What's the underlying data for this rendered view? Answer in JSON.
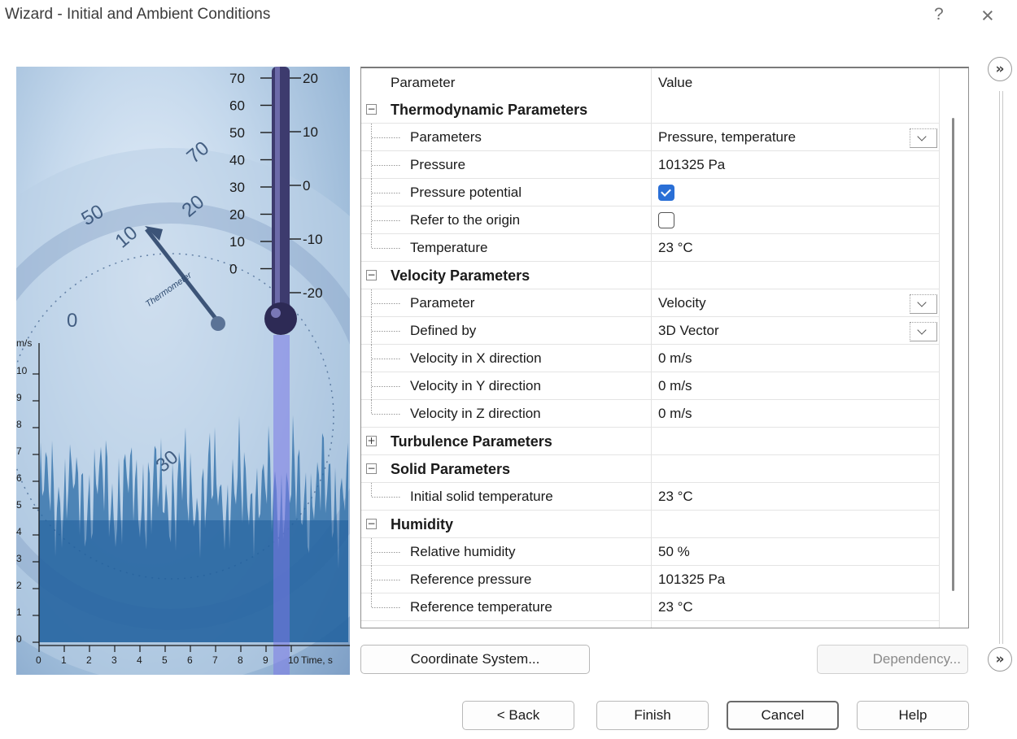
{
  "window": {
    "title": "Wizard - Initial and Ambient Conditions",
    "help_glyph": "?",
    "close_glyph": "×"
  },
  "illustration": {
    "thermo_left_ticks": [
      "70",
      "60",
      "50",
      "40",
      "30",
      "20",
      "10",
      "0"
    ],
    "thermo_right_ticks": [
      "20",
      "10",
      "0",
      "-10",
      "-20"
    ],
    "dial_numbers": [
      "50",
      "70",
      "20",
      "10",
      "0",
      "30"
    ],
    "dial_label": "Thermometer",
    "y_unit": "m/s",
    "y_ticks": [
      "10",
      "9",
      "8",
      "7",
      "6",
      "5",
      "4",
      "3",
      "2",
      "1",
      "0"
    ],
    "x_ticks": [
      "0",
      "1",
      "2",
      "3",
      "4",
      "5",
      "6",
      "7",
      "8",
      "9",
      "10"
    ],
    "x_label": "Time, s"
  },
  "grid": {
    "header": {
      "parameter": "Parameter",
      "value": "Value"
    },
    "rows": [
      {
        "type": "category",
        "label": "Thermodynamic Parameters",
        "expanded": true
      },
      {
        "type": "prop",
        "label": "Parameters",
        "value": "Pressure, temperature",
        "combo": true
      },
      {
        "type": "prop",
        "label": "Pressure",
        "value": "101325 Pa"
      },
      {
        "type": "check",
        "label": "Pressure potential",
        "checked": true
      },
      {
        "type": "check",
        "label": "Refer to the origin",
        "checked": false
      },
      {
        "type": "prop",
        "label": "Temperature",
        "value": "23 °C",
        "last": true
      },
      {
        "type": "category",
        "label": "Velocity Parameters",
        "expanded": true
      },
      {
        "type": "prop",
        "label": "Parameter",
        "value": "Velocity",
        "combo": true
      },
      {
        "type": "prop",
        "label": "Defined by",
        "value": "3D Vector",
        "combo": true
      },
      {
        "type": "prop",
        "label": "Velocity in X direction",
        "value": "0 m/s"
      },
      {
        "type": "prop",
        "label": "Velocity in Y direction",
        "value": "0 m/s"
      },
      {
        "type": "prop",
        "label": "Velocity in Z direction",
        "value": "0 m/s",
        "last": true
      },
      {
        "type": "category",
        "label": "Turbulence Parameters",
        "expanded": false
      },
      {
        "type": "category",
        "label": "Solid Parameters",
        "expanded": true
      },
      {
        "type": "prop",
        "label": "Initial solid temperature",
        "value": "23 °C",
        "last": true
      },
      {
        "type": "category",
        "label": "Humidity",
        "expanded": true
      },
      {
        "type": "prop",
        "label": "Relative humidity",
        "value": "50 %"
      },
      {
        "type": "prop",
        "label": "Reference pressure",
        "value": "101325 Pa"
      },
      {
        "type": "prop",
        "label": "Reference temperature",
        "value": "23 °C",
        "last": true
      }
    ]
  },
  "side": {
    "expand_glyph": "»"
  },
  "buttons": {
    "coordinate_system": "Coordinate System...",
    "dependency": "Dependency...",
    "back": "< Back",
    "finish": "Finish",
    "cancel": "Cancel",
    "help": "Help"
  }
}
